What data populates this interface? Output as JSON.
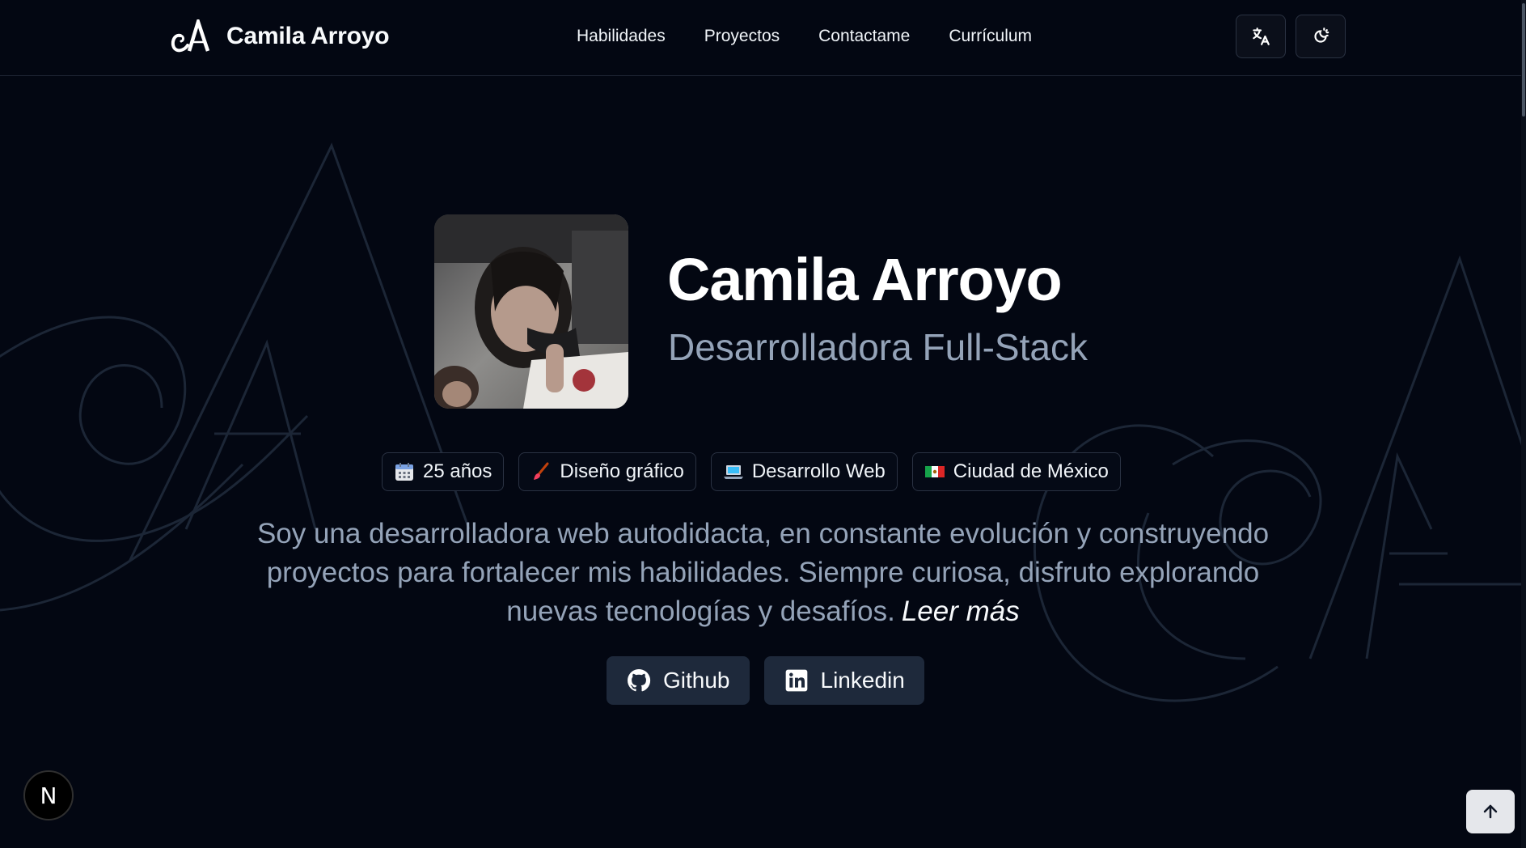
{
  "header": {
    "brand_name": "Camila Arroyo",
    "nav": [
      {
        "label": "Habilidades"
      },
      {
        "label": "Proyectos"
      },
      {
        "label": "Contactame"
      },
      {
        "label": "Currículum"
      }
    ],
    "buttons": {
      "language": "translate-icon",
      "theme": "theme-toggle-icon"
    }
  },
  "hero": {
    "name": "Camila Arroyo",
    "role": "Desarrolladora Full-Stack",
    "badges": [
      {
        "icon": "calendar-icon",
        "label": "25 años"
      },
      {
        "icon": "paintbrush-icon",
        "label": "Diseño gráfico"
      },
      {
        "icon": "laptop-icon",
        "label": "Desarrollo Web"
      },
      {
        "icon": "mexico-flag-icon",
        "label": "Ciudad de México"
      }
    ],
    "bio": "Soy una desarrolladora web autodidacta, en constante evolución y construyendo proyectos para fortalecer mis habilidades. Siempre curiosa, disfruto explorando nuevas tecnologías y desafíos.",
    "read_more": "Leer más",
    "socials": [
      {
        "icon": "github-icon",
        "label": "Github"
      },
      {
        "icon": "linkedin-icon",
        "label": "Linkedin"
      }
    ]
  },
  "floating": {
    "next_badge": "N",
    "scroll_top_icon": "arrow-up-icon"
  },
  "colors": {
    "background": "#030712",
    "text_primary": "#f8fafc",
    "text_muted": "#94a3b8",
    "surface": "#1e293b",
    "border": "#2a3242"
  }
}
